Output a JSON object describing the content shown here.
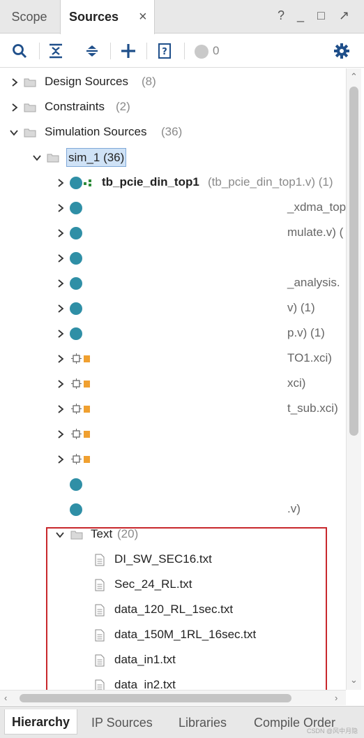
{
  "tabs": {
    "scope": "Scope",
    "sources": "Sources",
    "close": "×"
  },
  "window_controls": [
    "?",
    "_",
    "□",
    "↗"
  ],
  "toolbar": {
    "message_count": "0"
  },
  "tree": {
    "design_sources": {
      "label": "Design Sources",
      "count": "(8)"
    },
    "constraints": {
      "label": "Constraints",
      "count": "(2)"
    },
    "simulation_sources": {
      "label": "Simulation Sources",
      "count": "(36)"
    },
    "sim_1": {
      "label": "sim_1 (36)"
    },
    "top_module": {
      "label": "tb_pcie_din_top1",
      "detail": "(tb_pcie_din_top1.v) (1)"
    },
    "partial_rows": [
      "_xdma_top",
      "mulate.v) (",
      "",
      "_analysis.",
      "v) (1)",
      "p.v) (1)",
      "TO1.xci)",
      "xci)",
      "t_sub.xci)",
      "",
      "",
      "",
      ".v)"
    ],
    "text_folder": {
      "label": "Text",
      "count": "(20)"
    },
    "text_files": [
      "DI_SW_SEC16.txt",
      "Sec_24_RL.txt",
      "data_120_RL_1sec.txt",
      "data_150M_1RL_16sec.txt",
      "data_in1.txt",
      "data_in2.txt"
    ]
  },
  "bottom_tabs": [
    "Hierarchy",
    "IP Sources",
    "Libraries",
    "Compile Order"
  ],
  "watermark": "CSDN @风中月隐",
  "colors": {
    "module_dot": "#2f8fa6",
    "selection": "#cfe2f6",
    "highlight_box": "#c8282c"
  }
}
